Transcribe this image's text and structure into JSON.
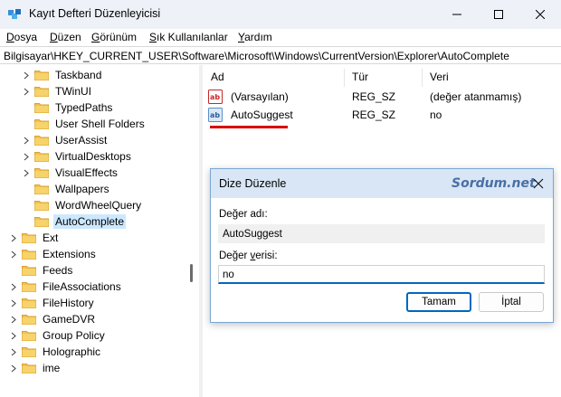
{
  "window": {
    "title": "Kayıt Defteri Düzenleyicisi"
  },
  "menu": [
    {
      "label_ul": "D",
      "label_rest": "osya"
    },
    {
      "label_ul": "D",
      "label_rest": "üzen"
    },
    {
      "label_ul": "G",
      "label_rest": "örünüm"
    },
    {
      "label_ul": "S",
      "label_rest": "ık Kullanılanlar"
    },
    {
      "label_ul": "Y",
      "label_rest": "ardım"
    }
  ],
  "address": "Bilgisayar\\HKEY_CURRENT_USER\\Software\\Microsoft\\Windows\\CurrentVersion\\Explorer\\AutoComplete",
  "tree": [
    {
      "label": "Taskband",
      "expandable": true
    },
    {
      "label": "TWinUI",
      "expandable": true
    },
    {
      "label": "TypedPaths",
      "expandable": false
    },
    {
      "label": "User Shell Folders",
      "expandable": false
    },
    {
      "label": "UserAssist",
      "expandable": true
    },
    {
      "label": "VirtualDesktops",
      "expandable": true
    },
    {
      "label": "VisualEffects",
      "expandable": true
    },
    {
      "label": "Wallpapers",
      "expandable": false
    },
    {
      "label": "WordWheelQuery",
      "expandable": false
    },
    {
      "label": "AutoComplete",
      "expandable": false,
      "selected": true
    },
    {
      "label": "Ext",
      "expandable": true
    },
    {
      "label": "Extensions",
      "expandable": true
    },
    {
      "label": "Feeds",
      "expandable": false
    },
    {
      "label": "FileAssociations",
      "expandable": true
    },
    {
      "label": "FileHistory",
      "expandable": true
    },
    {
      "label": "GameDVR",
      "expandable": true
    },
    {
      "label": "Group Policy",
      "expandable": true
    },
    {
      "label": "Holographic",
      "expandable": true
    },
    {
      "label": "ime",
      "expandable": true
    }
  ],
  "columns": {
    "name": "Ad",
    "type": "Tür",
    "data": "Veri"
  },
  "values": [
    {
      "name": "(Varsayılan)",
      "type": "REG_SZ",
      "data": "(değer atanmamış)"
    },
    {
      "name": "AutoSuggest",
      "type": "REG_SZ",
      "data": "no"
    }
  ],
  "dialog": {
    "title": "Dize Düzenle",
    "watermark": "Sordum.net",
    "name_label": "Değer adı:",
    "name_value": "AutoSuggest",
    "data_label_pre": "Değer ",
    "data_label_ul": "v",
    "data_label_post": "erisi:",
    "data_value": "no",
    "ok_label": "Tamam",
    "cancel_label": "İptal"
  },
  "colors": {
    "selection": "#cce8ff",
    "folder": "#f3c24f",
    "accent": "#0067c0",
    "annotation": "#d90000"
  }
}
